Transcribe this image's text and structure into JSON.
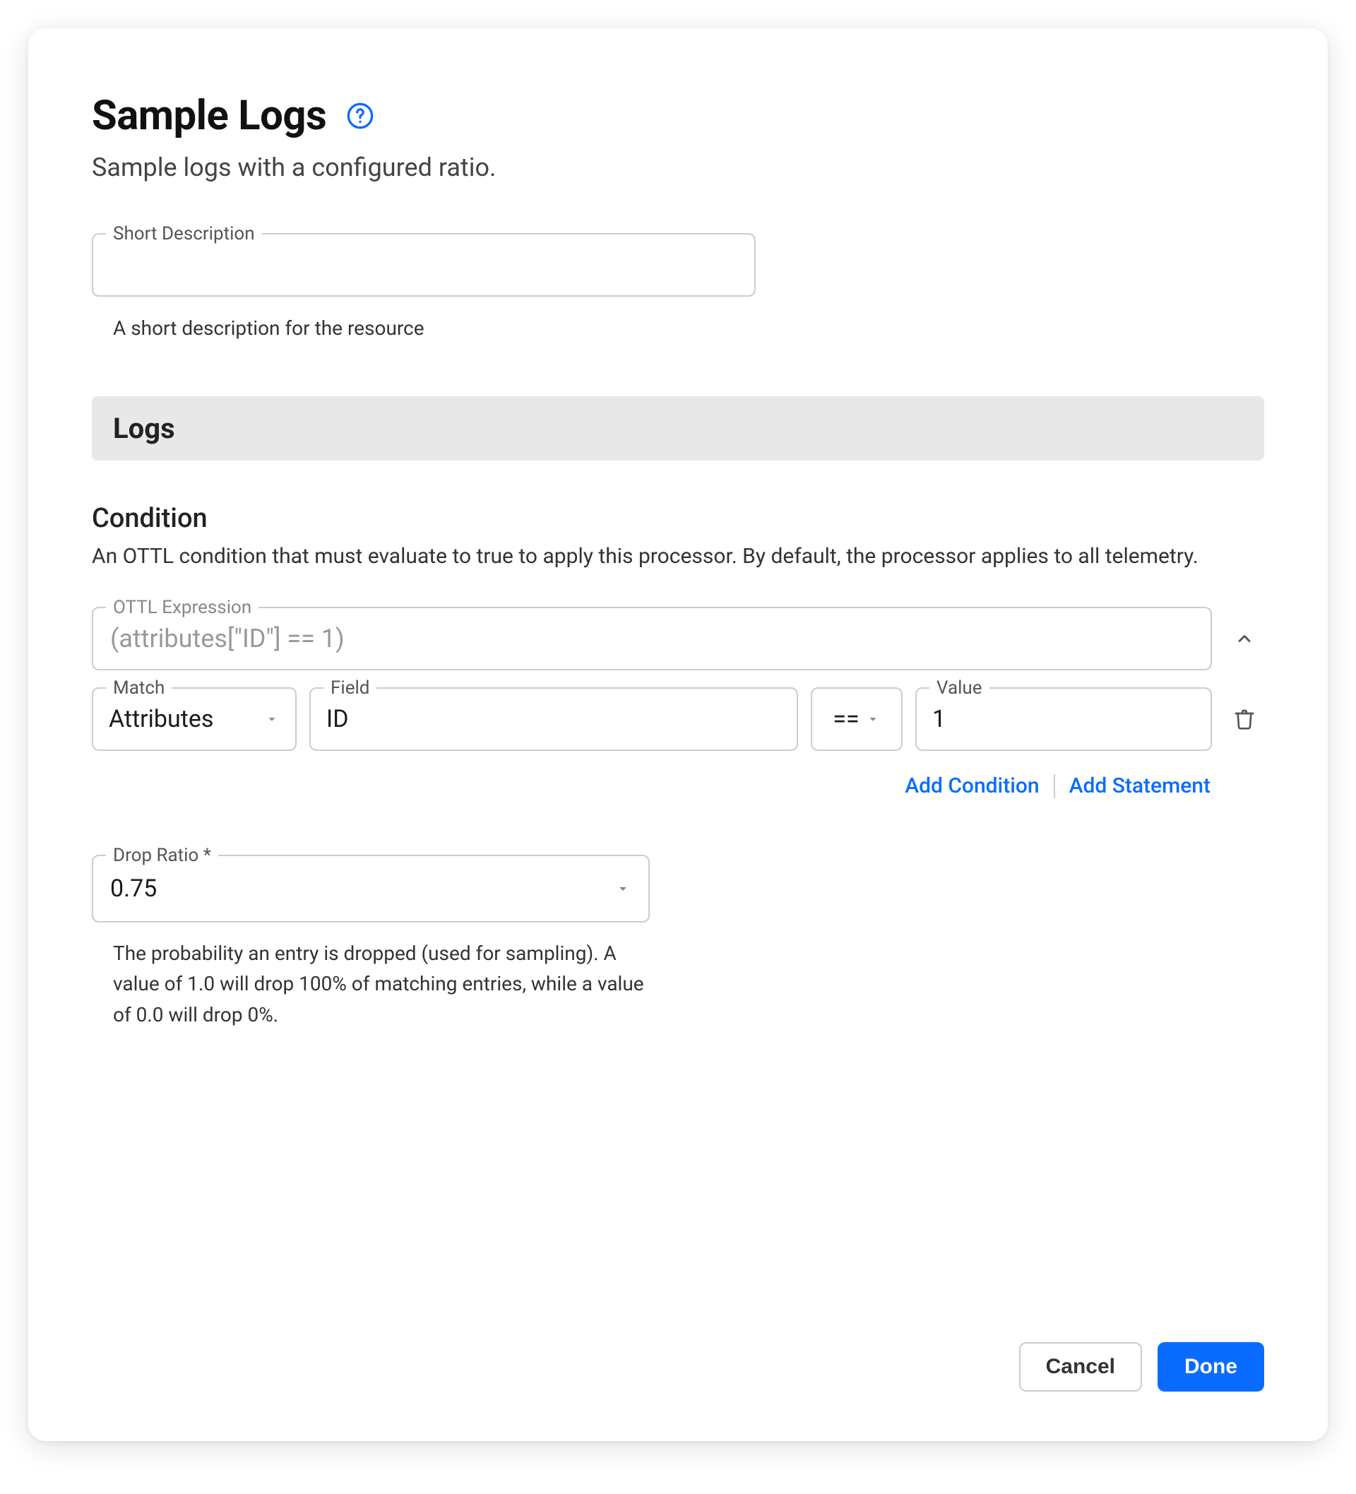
{
  "header": {
    "title": "Sample Logs",
    "subtitle": "Sample logs with a configured ratio."
  },
  "shortDescription": {
    "label": "Short Description",
    "value": "",
    "helper": "A short description for the resource"
  },
  "section": {
    "logs_label": "Logs"
  },
  "condition": {
    "title": "Condition",
    "description": "An OTTL condition that must evaluate to true to apply this processor. By default, the processor applies to all telemetry.",
    "expression_label": "OTTL Expression",
    "expression_value": "(attributes[\"ID\"] == 1)",
    "match_label": "Match",
    "match_value": "Attributes",
    "field_label": "Field",
    "field_value": "ID",
    "operator": "==",
    "value_label": "Value",
    "value_value": "1",
    "add_condition": "Add Condition",
    "add_statement": "Add Statement"
  },
  "dropRatio": {
    "label": "Drop Ratio *",
    "value": "0.75",
    "helper": "The probability an entry is dropped (used for sampling). A value of 1.0 will drop 100% of matching entries, while a value of 0.0 will drop 0%."
  },
  "footer": {
    "cancel": "Cancel",
    "done": "Done"
  }
}
